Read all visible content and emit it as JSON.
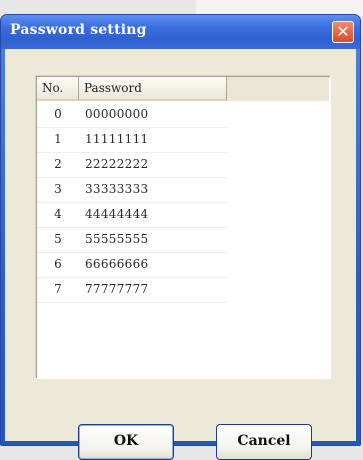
{
  "window": {
    "title": "Password setting",
    "close_glyph": "✕"
  },
  "list": {
    "columns": [
      "No.",
      "Password"
    ],
    "rows": [
      {
        "no": "0",
        "password": "00000000"
      },
      {
        "no": "1",
        "password": "11111111"
      },
      {
        "no": "2",
        "password": "22222222"
      },
      {
        "no": "3",
        "password": "33333333"
      },
      {
        "no": "4",
        "password": "44444444"
      },
      {
        "no": "5",
        "password": "55555555"
      },
      {
        "no": "6",
        "password": "66666666"
      },
      {
        "no": "7",
        "password": "77777777"
      }
    ]
  },
  "buttons": {
    "ok": "OK",
    "cancel": "Cancel"
  },
  "colors": {
    "titlebar": "#2e60d2",
    "close_button": "#dc4a2c",
    "client_bg": "#ece9d8"
  },
  "icons": {
    "close": "close-icon"
  }
}
